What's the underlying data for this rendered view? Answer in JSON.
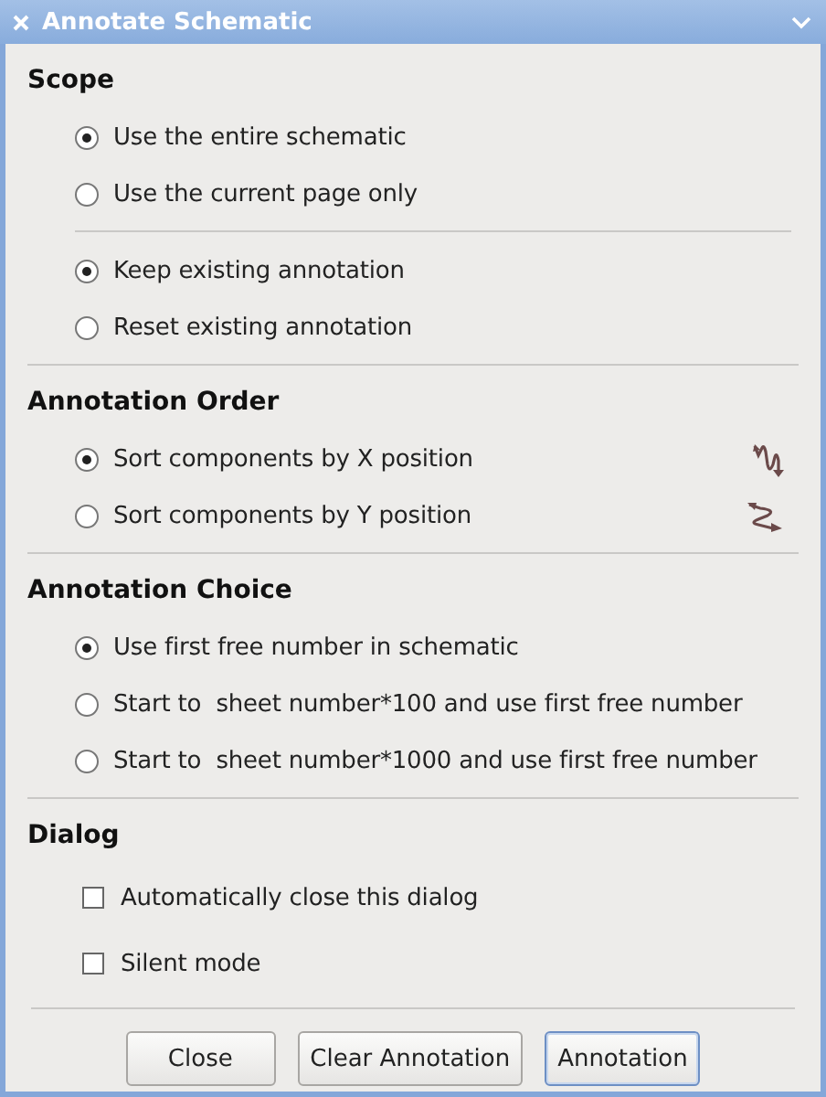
{
  "window": {
    "title": "Annotate Schematic"
  },
  "sections": [
    {
      "title": "Scope",
      "groups": [
        [
          {
            "kind": "radio",
            "label": "Use the entire schematic",
            "selected": true
          },
          {
            "kind": "radio",
            "label": "Use the current page only",
            "selected": false
          }
        ],
        [
          {
            "kind": "radio",
            "label": "Keep existing annotation",
            "selected": true
          },
          {
            "kind": "radio",
            "label": "Reset existing annotation",
            "selected": false
          }
        ]
      ]
    },
    {
      "title": "Annotation Order",
      "groups": [
        [
          {
            "kind": "radio",
            "label": "Sort components by X position",
            "selected": true
          },
          {
            "kind": "radio",
            "label": "Sort components by Y position",
            "selected": false
          }
        ]
      ]
    },
    {
      "title": "Annotation Choice",
      "groups": [
        [
          {
            "kind": "radio",
            "label": "Use first free number in schematic",
            "selected": true
          },
          {
            "kind": "radio",
            "label": "Start to  sheet number*100 and use first free number",
            "selected": false
          },
          {
            "kind": "radio",
            "label": "Start to  sheet number*1000 and use first free number",
            "selected": false
          }
        ]
      ]
    },
    {
      "title": "Dialog",
      "groups": [
        [
          {
            "kind": "checkbox",
            "label": "Automatically close this dialog",
            "checked": false
          },
          {
            "kind": "checkbox",
            "label": "Silent mode",
            "checked": false
          }
        ]
      ]
    }
  ],
  "buttons": [
    {
      "label": "Close",
      "default": false
    },
    {
      "label": "Clear Annotation",
      "default": false
    },
    {
      "label": "Annotation",
      "default": true
    }
  ]
}
